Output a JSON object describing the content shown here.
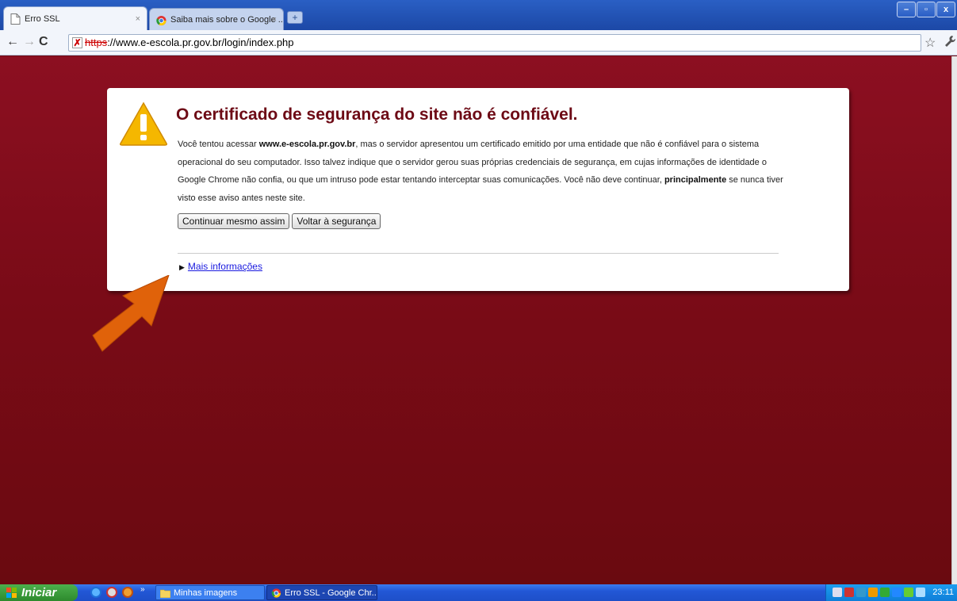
{
  "browser": {
    "tabs": [
      {
        "title": "Erro SSL",
        "close": "×"
      },
      {
        "title": "Saiba mais sobre o Google ...",
        "close": "×"
      }
    ],
    "new_tab": "+",
    "window_controls": {
      "minimize": "–",
      "restore": "▫",
      "close": "x"
    }
  },
  "toolbar": {
    "back": "←",
    "forward": "→",
    "reload": "C",
    "url_scheme": "https",
    "url_rest": "://www.e-escola.pr.gov.br/login/index.php",
    "star": "☆",
    "wrench": "🔧"
  },
  "page": {
    "title": "O certificado de segurança do site não é confiável.",
    "body_1": "Você tentou acessar ",
    "host": "www.e-escola.pr.gov.br",
    "body_2": ", mas o servidor apresentou um certificado emitido por uma entidade que não é confiável para o sistema operacional do seu computador. Isso talvez indique que o servidor gerou suas próprias credenciais de segurança, em cujas informações de identidade o Google Chrome não confia, ou que um intruso pode estar tentando interceptar suas comunicações. Você não deve continuar, ",
    "body_bold": "principalmente",
    "body_3": " se nunca tiver visto esse aviso antes neste site.",
    "proceed_label": "Continuar mesmo assim",
    "back_label": "Voltar à segurança",
    "more_info_arrow": "▶",
    "more_info_label": "Mais informações"
  },
  "taskbar": {
    "start_label": "Iniciar",
    "more": "»",
    "tasks": [
      "Minhas imagens",
      "Erro SSL - Google Chr..."
    ],
    "clock": "23:11"
  },
  "colors": {
    "page_background": "#7a0b17",
    "title_color": "#6d0a15",
    "warning_yellow": "#f5b700",
    "annotation_arrow": "#e0620a"
  }
}
